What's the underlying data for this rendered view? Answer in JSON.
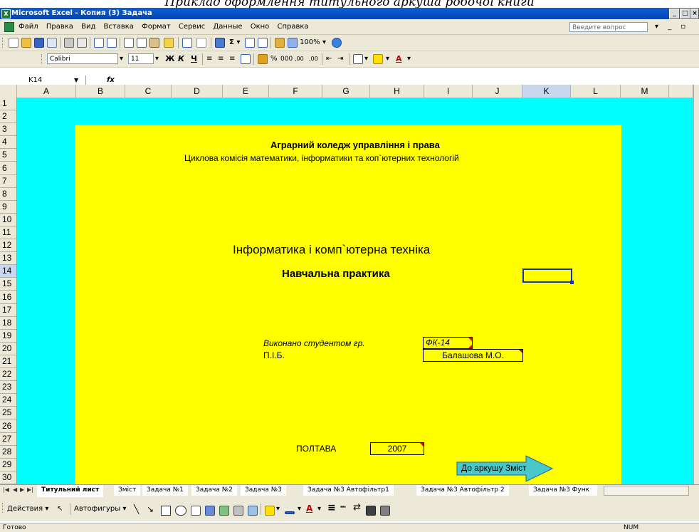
{
  "caption": "Приклад оформлення титульного аркуша робочої книги",
  "window": {
    "title": "Microsoft Excel - Копия (3) Задача"
  },
  "menu": {
    "items": [
      "Файл",
      "Правка",
      "Вид",
      "Вставка",
      "Формат",
      "Сервис",
      "Данные",
      "Окно",
      "Справка"
    ],
    "question_placeholder": "Введите вопрос"
  },
  "toolbar": {
    "zoom": "100%",
    "font": "Calibri",
    "font_size": "11"
  },
  "formula_bar": {
    "cell_ref": "K14",
    "fx": "fx"
  },
  "columns": [
    "A",
    "B",
    "C",
    "D",
    "E",
    "F",
    "G",
    "H",
    "I",
    "J",
    "K",
    "L",
    "M"
  ],
  "selected_column": "K",
  "rows": [
    "1",
    "2",
    "3",
    "4",
    "5",
    "6",
    "7",
    "8",
    "9",
    "10",
    "11",
    "12",
    "13",
    "14",
    "15",
    "16",
    "17",
    "18",
    "19",
    "20",
    "21",
    "22",
    "23",
    "24",
    "25",
    "26",
    "27",
    "28",
    "29",
    "30"
  ],
  "selected_row": "14",
  "sheet": {
    "college": "Аграрний коледж управління і права",
    "commission": "Циклова комісія математики, інформатики та коп`ютерних технологій",
    "subject": "Інформатика і комп`ютерна техніка",
    "practice": "Навчальна практика",
    "done_by": "Виконано студентом гр.",
    "group": "ФК-14",
    "name_label": "П.І.Б.",
    "student": "Балашова М.О.",
    "city": "ПОЛТАВА",
    "year": "2007",
    "to_contents": "До аркушу Зміст"
  },
  "colors": {
    "sheet_bg": "#00ffff",
    "title_block": "#ffff00",
    "arrow": "#48c8c8"
  },
  "tabs": [
    "Титульний лист",
    "Зміст",
    "Задача №1",
    "Задача №2",
    "Задача №3",
    "Задача №3 Автофільтр1",
    "Задача №3 Автофільтр 2",
    "Задача №3 Функ"
  ],
  "active_tab": "Титульний лист",
  "drawing": {
    "actions": "Действия",
    "autoshapes": "Автофигуры"
  },
  "status": {
    "ready": "Готово",
    "num": "NUM"
  }
}
